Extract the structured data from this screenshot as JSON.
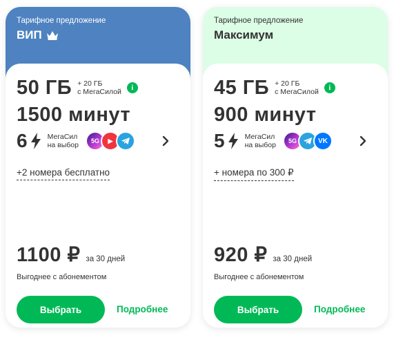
{
  "colors": {
    "vip_header": "#4e82c0",
    "max_header": "#dcfde6",
    "accent_green": "#00b956",
    "text": "#333333"
  },
  "cards": [
    {
      "eyebrow": "Тарифное предложение",
      "name": "ВИП",
      "name_icon": "crown-icon",
      "gb": "50 ГБ",
      "bonus_line1": "+ 20 ГБ",
      "bonus_line2": "с МегаСилой",
      "minutes": "1500 минут",
      "megasil_count": "6",
      "megasil_line1": "МегаСил",
      "megasil_line2": "на выбор",
      "apps": [
        {
          "icon": "megafon-5g-app-icon",
          "text": "5G"
        },
        {
          "icon": "youtube-icon",
          "text": "▶"
        },
        {
          "icon": "telegram-icon",
          "text": ""
        }
      ],
      "extra": "+2 номера бесплатно",
      "price": "1100 ₽",
      "period": "за 30 дней",
      "promo": "Выгоднее с абонементом",
      "select_label": "Выбрать",
      "more_label": "Подробнее"
    },
    {
      "eyebrow": "Тарифное предложение",
      "name": "Максимум",
      "name_icon": "",
      "gb": "45 ГБ",
      "bonus_line1": "+ 20 ГБ",
      "bonus_line2": "с МегаСилой",
      "minutes": "900 минут",
      "megasil_count": "5",
      "megasil_line1": "МегаСил",
      "megasil_line2": "на выбор",
      "apps": [
        {
          "icon": "megafon-5g-app-icon",
          "text": "5G"
        },
        {
          "icon": "telegram-icon",
          "text": ""
        },
        {
          "icon": "vk-icon",
          "text": "VK"
        }
      ],
      "extra": "+ номера по 300 ₽",
      "price": "920 ₽",
      "period": "за 30 дней",
      "promo": "Выгоднее с абонементом",
      "select_label": "Выбрать",
      "more_label": "Подробнее"
    }
  ]
}
